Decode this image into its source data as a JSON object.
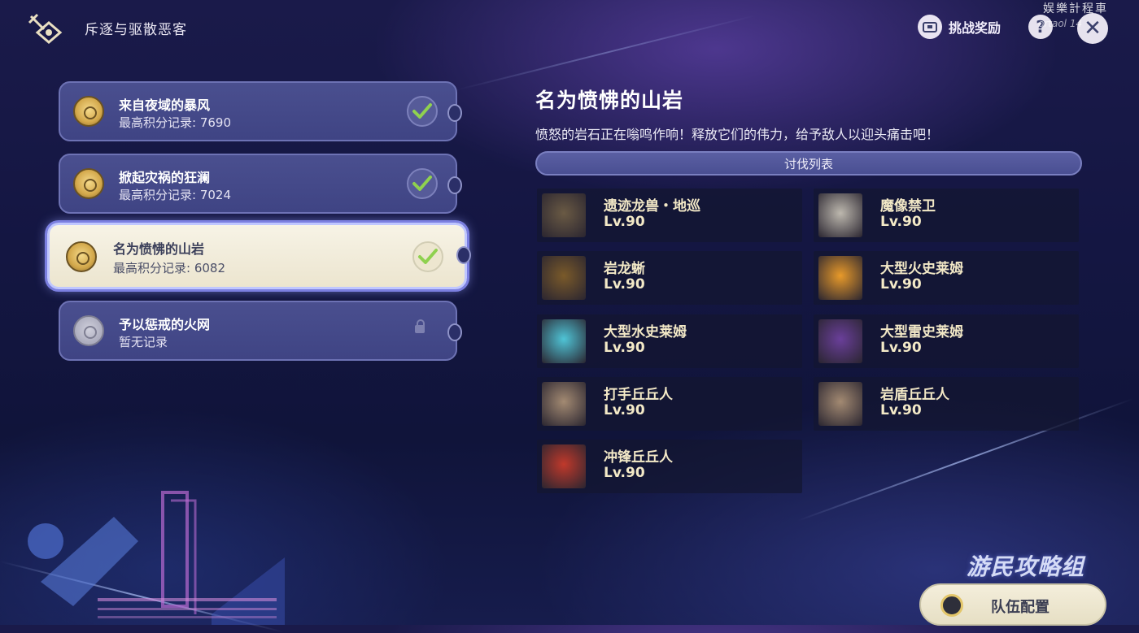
{
  "header": {
    "title": "斥逐与驱散恶客",
    "reward_label": "挑战奖励",
    "help_glyph": "?",
    "close_glyph": "✕"
  },
  "watermark": {
    "line1": "娱樂計程車",
    "line2": "ortaol 14"
  },
  "challenges": [
    {
      "title": "来自夜域的暴风",
      "score": "最高积分记录: 7690",
      "state": "completed"
    },
    {
      "title": "掀起灾祸的狂澜",
      "score": "最高积分记录: 7024",
      "state": "completed"
    },
    {
      "title": "名为愤怫的山岩",
      "score": "最高积分记录: 6082",
      "state": "selected-completed"
    },
    {
      "title": "予以惩戒的火网",
      "score": "暂无记录",
      "state": "locked"
    }
  ],
  "detail": {
    "title": "名为愤怫的山岩",
    "description": "愤怒的岩石正在嗡鸣作响！释放它们的伟力，给予敌人以迎头痛击吧！",
    "list_header": "讨伐列表",
    "enemies": [
      {
        "name": "遗迹龙兽・地巡",
        "level": "Lv.90",
        "portrait_color": "#6a5a44"
      },
      {
        "name": "魔像禁卫",
        "level": "Lv.90",
        "portrait_color": "#bdb8ae"
      },
      {
        "name": "岩龙蜥",
        "level": "Lv.90",
        "portrait_color": "#7a5a2a"
      },
      {
        "name": "大型火史莱姆",
        "level": "Lv.90",
        "portrait_color": "#e89a2a"
      },
      {
        "name": "大型水史莱姆",
        "level": "Lv.90",
        "portrait_color": "#4fc4d6"
      },
      {
        "name": "大型雷史莱姆",
        "level": "Lv.90",
        "portrait_color": "#6a3f9a"
      },
      {
        "name": "打手丘丘人",
        "level": "Lv.90",
        "portrait_color": "#a38a72"
      },
      {
        "name": "岩盾丘丘人",
        "level": "Lv.90",
        "portrait_color": "#a38a72"
      },
      {
        "name": "冲锋丘丘人",
        "level": "Lv.90",
        "portrait_color": "#c0392b"
      }
    ]
  },
  "footer": {
    "team_button": "队伍配置",
    "brand": "游民攻略组"
  },
  "colors": {
    "accent_gold": "#f3e9c7",
    "check_green": "#8fd14f",
    "panel_purple": "#4a4f8f"
  }
}
